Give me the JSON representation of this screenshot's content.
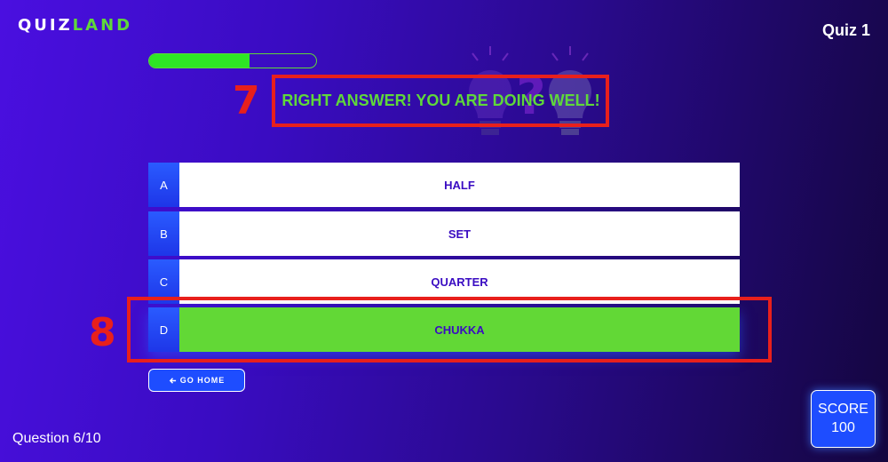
{
  "header": {
    "logo_part1": "QUIZ",
    "logo_part2": "LAND",
    "quiz_name": "Quiz 1"
  },
  "progress": {
    "fraction": 0.6
  },
  "feedback": {
    "message": "RIGHT ANSWER! YOU ARE DOING WELL!"
  },
  "annotations": {
    "feedback_marker": "7",
    "correct_answer_marker": "8"
  },
  "answers": [
    {
      "letter": "A",
      "text": "HALF",
      "correct": false
    },
    {
      "letter": "B",
      "text": "SET",
      "correct": false
    },
    {
      "letter": "C",
      "text": "QUARTER",
      "correct": false
    },
    {
      "letter": "D",
      "text": "CHUKKA",
      "correct": true
    }
  ],
  "footer": {
    "go_home_label": "GO HOME",
    "go_home_icon": "arrow-left-icon",
    "question_counter": "Question 6/10",
    "score_label": "SCORE",
    "score_value": "100"
  },
  "colors": {
    "accent_green": "#5fd83a",
    "correct_green": "#62d836",
    "annotation_red": "#e8201c",
    "button_blue": "#1e4dff",
    "answer_text": "#3a0cc2"
  }
}
